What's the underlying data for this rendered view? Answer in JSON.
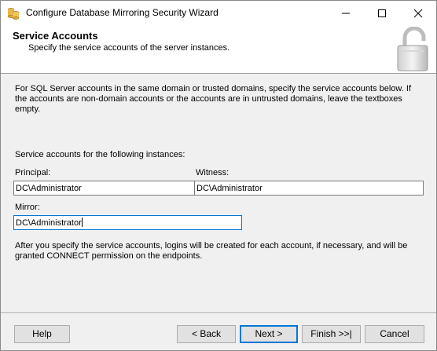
{
  "window": {
    "title": "Configure Database Mirroring Security Wizard"
  },
  "header": {
    "title": "Service Accounts",
    "subtitle": "Specify the service accounts of the server instances."
  },
  "intro_text": "For SQL Server accounts in the same domain or trusted domains, specify the service accounts below. If the accounts are non-domain accounts or the accounts are in untrusted domains, leave the textboxes empty.",
  "section_label": "Service accounts for the following instances:",
  "fields": {
    "principal": {
      "label": "Principal:",
      "value": "DC\\Administrator"
    },
    "witness": {
      "label": "Witness:",
      "value": "DC\\Administrator"
    },
    "mirror": {
      "label": "Mirror:",
      "value": "DC\\Administrator"
    }
  },
  "after_text": "After you specify the service accounts, logins will be created for each account, if necessary, and will be granted CONNECT permission on the endpoints.",
  "buttons": {
    "help": "Help",
    "back": "< Back",
    "next": "Next >",
    "finish": "Finish >>|",
    "cancel": "Cancel"
  },
  "icons": [
    "app-icon",
    "minimize-icon",
    "maximize-icon",
    "close-icon",
    "padlock-icon"
  ],
  "colors": {
    "accent": "#0078d7",
    "header_bg": "#ffffff",
    "dialog_bg": "#f0f0f0"
  }
}
